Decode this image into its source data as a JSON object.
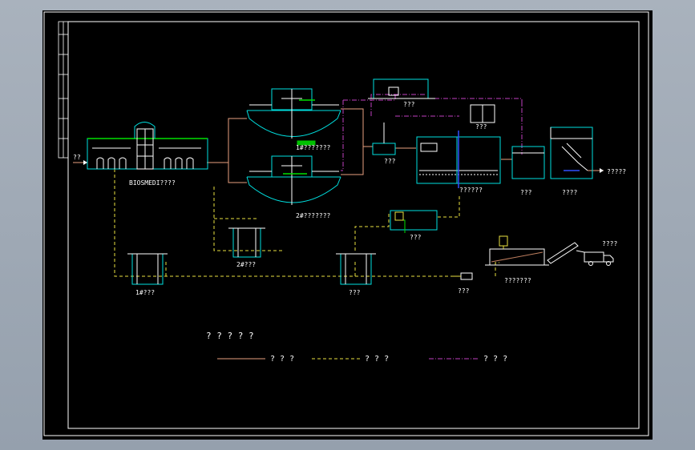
{
  "viewer": {
    "background": "#9aa4b0",
    "sheet_color": "#000000"
  },
  "drawing": {
    "legend_title": "? ? ? ? ?",
    "legend": [
      {
        "label": "? ? ?",
        "color": "#e8a080",
        "style": "solid"
      },
      {
        "label": "? ? ?",
        "color": "#e8e040",
        "style": "dashed"
      },
      {
        "label": "? ? ?",
        "color": "#c040c0",
        "style": "dashdot"
      }
    ],
    "labels": {
      "inlet_arrow": "??",
      "bio_pool": "BIOSMEDI????",
      "clarifier_1": "1#???????",
      "clarifier_2": "2#???????",
      "pump_house": "???",
      "blower_room": "???",
      "dosing_tank": "???",
      "filter_pool": "??????",
      "disinfection": "???",
      "outlet_room": "????",
      "outlet_arrow": "?????",
      "sludge_pit_small": "???",
      "pump_well_1": "1#???",
      "pump_well_2": "2#???",
      "sludge_well": "???",
      "sludge_pump": "???",
      "dewatering": "???????",
      "truck": "????"
    },
    "colors": {
      "frame": "#ffffff",
      "structure": "#00e0e0",
      "water_line": "#e8a080",
      "sludge_line": "#e8e040",
      "air_line": "#c040c0",
      "green": "#00c000",
      "label": "#ffffff"
    }
  }
}
